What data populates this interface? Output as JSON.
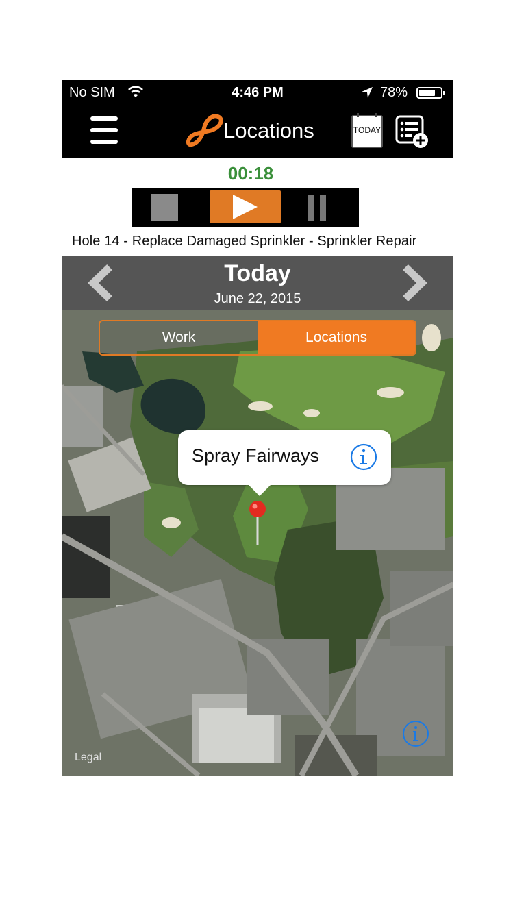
{
  "status_bar": {
    "carrier": "No SIM",
    "time": "4:46 PM",
    "battery_percent": "78%",
    "battery_level": 0.78,
    "icons": [
      "wifi-icon",
      "location-arrow-icon",
      "battery-icon"
    ]
  },
  "nav": {
    "title": "Locations",
    "today_button_label": "TODAY",
    "icons": [
      "hamburger-menu-icon",
      "brand-logo-icon",
      "calendar-today-icon",
      "add-list-icon"
    ],
    "accent_color": "#e07a25"
  },
  "timer": {
    "elapsed": "00:18",
    "controls": [
      "stop-icon",
      "play-icon",
      "pause-icon"
    ]
  },
  "task": {
    "name": "Hole 14 - Replace Damaged Sprinkler - Sprinkler Repair"
  },
  "date_header": {
    "title": "Today",
    "date": "June 22, 2015",
    "icons": [
      "chevron-left-icon",
      "chevron-right-icon"
    ]
  },
  "map": {
    "tabs": [
      {
        "label": "Work",
        "selected": false
      },
      {
        "label": "Locations",
        "selected": true
      }
    ],
    "callout_title": "Spray Fairways",
    "legal_label": "Legal",
    "icons": [
      "info-icon",
      "map-pin-icon"
    ]
  }
}
